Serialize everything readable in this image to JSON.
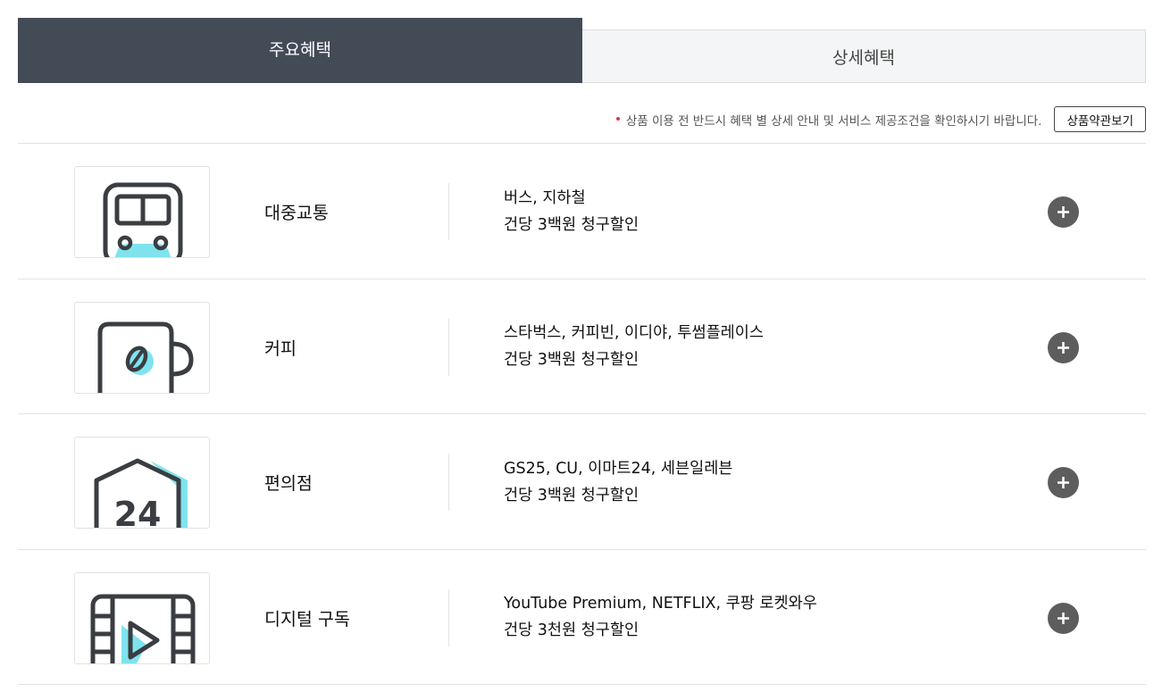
{
  "tabs": [
    {
      "label": "주요혜택",
      "active": true
    },
    {
      "label": "상세혜택",
      "active": false
    }
  ],
  "notice": {
    "text": "상품 이용 전 반드시 혜택 별 상세 안내 및 서비스 제공조건을 확인하시기 바랍니다.",
    "button_label": "상품약관보기"
  },
  "colors": {
    "tab_active_bg": "#434b57",
    "accent_cyan": "#7fe3ee",
    "icon_stroke": "#3a3d42",
    "notice_dot": "#e0394f",
    "plus_button": "#5d5d5d"
  },
  "benefits": [
    {
      "icon": "subway-icon",
      "category": "대중교통",
      "line1": "버스, 지하철",
      "line2": "건당 3백원 청구할인"
    },
    {
      "icon": "coffee-cup-icon",
      "category": "커피",
      "line1": "스타벅스, 커피빈, 이디야, 투썸플레이스",
      "line2": "건당 3백원 청구할인"
    },
    {
      "icon": "convenience-store-24-icon",
      "category": "편의점",
      "line1": "GS25, CU, 이마트24, 세븐일레븐",
      "line2": "건당 3백원 청구할인"
    },
    {
      "icon": "video-play-icon",
      "category": "디지털 구독",
      "line1": "YouTube Premium, NETFLIX, 쿠팡 로켓와우",
      "line2": "건당 3천원 청구할인"
    }
  ]
}
